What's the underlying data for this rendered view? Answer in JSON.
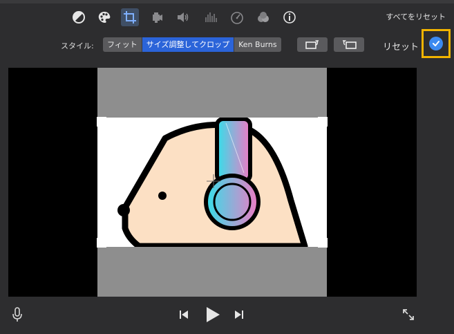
{
  "toolbar": {
    "icons": [
      "color-balance-icon",
      "palette-icon",
      "crop-icon",
      "camera-icon",
      "volume-icon",
      "equalizer-icon",
      "speed-icon",
      "filters-icon",
      "info-icon"
    ],
    "reset_all_label": "すべてをリセット"
  },
  "style_bar": {
    "label": "スタイル:",
    "options": [
      "フィット",
      "サイズ調整してクロップ",
      "Ken Burns"
    ],
    "selected": "サイズ調整してクロップ",
    "reset_label": "リセット"
  },
  "colors": {
    "accent": "#2b64d9",
    "apply": "#3c8af0",
    "highlight": "#f3b400",
    "bg": "#2d2d2f"
  },
  "bottom": {
    "icons": [
      "microphone-icon",
      "skip-back-icon",
      "play-icon",
      "skip-forward-icon",
      "fullscreen-icon"
    ]
  }
}
